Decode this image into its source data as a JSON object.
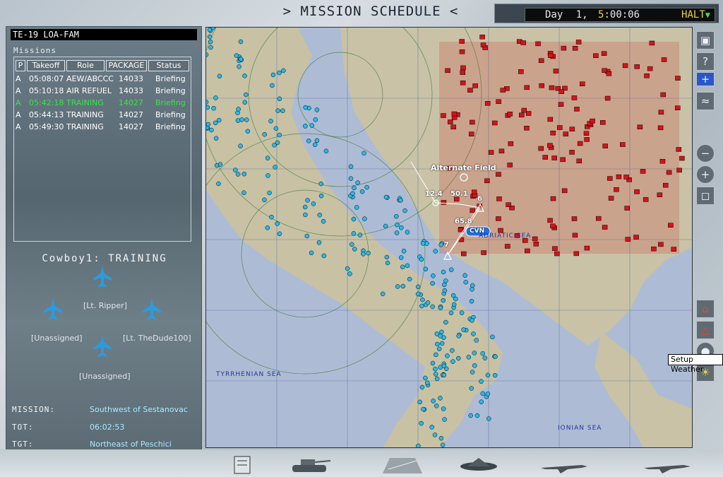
{
  "header": {
    "title": "> MISSION SCHEDULE <",
    "clock": {
      "day_label": "Day",
      "day_num": "1,",
      "hour": "5",
      "rest": ":00:06",
      "halt": "HALT",
      "halt_arrow": "▼"
    }
  },
  "flight": {
    "id": "TE-19 LOA-FAM",
    "missions_label": "Missions",
    "columns": [
      "P",
      "Takeoff",
      "Role",
      "PACKAGE",
      "Status"
    ],
    "rows": [
      {
        "p": "A",
        "takeoff": "05:08:07",
        "role": "AEW/ABCCC",
        "package": "14033",
        "status": "Briefing"
      },
      {
        "p": "A",
        "takeoff": "05:10:18",
        "role": "AIR REFUEL",
        "package": "14033",
        "status": "Briefing"
      },
      {
        "p": "A",
        "takeoff": "05:42:18",
        "role": "TRAINING",
        "package": "14027",
        "status": "Briefing"
      },
      {
        "p": "A",
        "takeoff": "05:44:13",
        "role": "TRAINING",
        "package": "14027",
        "status": "Briefing"
      },
      {
        "p": "A",
        "takeoff": "05:49:30",
        "role": "TRAINING",
        "package": "14027",
        "status": "Briefing"
      }
    ],
    "active_row": 2
  },
  "aircraft": {
    "title": "Cowboy1: TRAINING",
    "pilots": [
      "[Lt. Ripper]",
      "[Unassigned]",
      "[Lt. TheDude100]",
      "[Unassigned]"
    ]
  },
  "details": {
    "mission_label": "MISSION:",
    "mission_value": "Southwest of Sestanovac",
    "tot_label": "TOT:",
    "tot_value": "06:02:53",
    "tgt_label": "TGT:",
    "tgt_value": "Northeast of Peschici"
  },
  "map": {
    "labels": {
      "alternate_field": "Alternate Field",
      "adriatic": "ADRIATIC SEA",
      "tyrrhenian": "TYRRHENIAN SEA",
      "ionian": "IONIAN SEA",
      "cvn": "CVN",
      "wp1": "12.4",
      "wp2": "50.1",
      "wp3": "65.8",
      "wp4": "7",
      "wp5": "6"
    },
    "colors": {
      "friendly": "#2ab8e6",
      "enemy": "#d4141a",
      "sea": "#aebbd4",
      "land": "#c9c2a6"
    }
  },
  "toolbar": {
    "icons": [
      "window-icon",
      "help-icon",
      "layer-toggle-icon",
      "path-icon",
      "zoom-out-icon",
      "zoom-in-icon",
      "fit-icon",
      "threat-ring-icon",
      "threat-ring-2-icon",
      "satellite-icon",
      "weather-icon"
    ],
    "tooltip": "Setup Weather"
  }
}
